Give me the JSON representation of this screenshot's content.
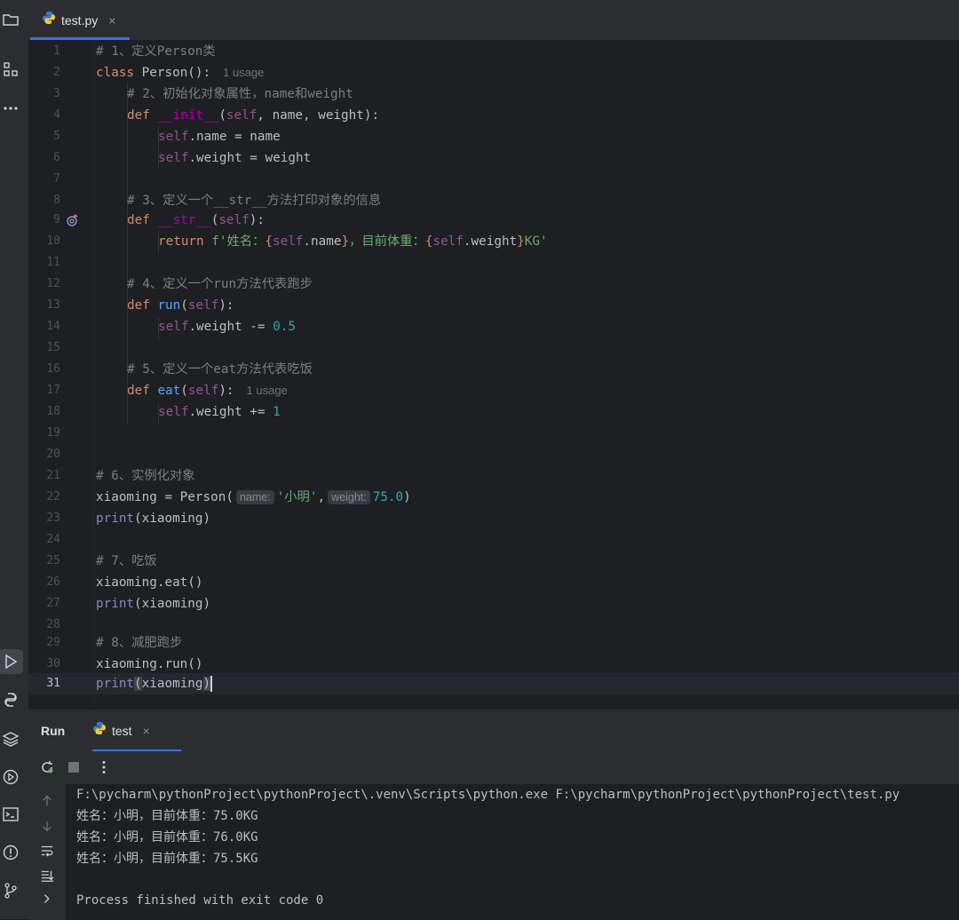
{
  "editor_tab": {
    "label": "test.py"
  },
  "gutter": [
    "1",
    "2",
    "3",
    "4",
    "5",
    "6",
    "7",
    "8",
    "9",
    "10",
    "11",
    "12",
    "13",
    "14",
    "15",
    "16",
    "17",
    "18",
    "19",
    "20",
    "21",
    "22",
    "23",
    "24",
    "25",
    "26",
    "27",
    "28",
    "29",
    "30",
    "31"
  ],
  "code": {
    "l1": "# 1、定义Person类",
    "l2_kw": "class",
    "l2_name": " Person():",
    "l2_hint": "1 usage",
    "l3": "# 2、初始化对象属性，name和weight",
    "l4_kw": "def ",
    "l4_fn": "__init__",
    "l4_a": "(",
    "l4_self": "self",
    "l4_b": ", name, weight):",
    "l5_self": "self",
    "l5_rest": ".name = name",
    "l6_self": "self",
    "l6_rest": ".weight = weight",
    "l8": "# 3、定义一个__str__方法打印对象的信息",
    "l9_kw": "def ",
    "l9_fn": "__str__",
    "l9_a": "(",
    "l9_self": "self",
    "l9_b": "):",
    "l10_kw": "return ",
    "l10_s1": "f'姓名：",
    "l10_b1": "{",
    "l10_self1": "self",
    "l10_n1": ".name",
    "l10_b2": "}",
    "l10_s2": "，目前体重：",
    "l10_b3": "{",
    "l10_self2": "self",
    "l10_n2": ".weight",
    "l10_b4": "}",
    "l10_s3": "KG'",
    "l12": "# 4、定义一个run方法代表跑步",
    "l13_kw": "def ",
    "l13_fn": "run",
    "l13_a": "(",
    "l13_self": "self",
    "l13_b": "):",
    "l14_self": "self",
    "l14_rest": ".weight -= ",
    "l14_num": "0.5",
    "l16": "# 5、定义一个eat方法代表吃饭",
    "l17_kw": "def ",
    "l17_fn": "eat",
    "l17_a": "(",
    "l17_self": "self",
    "l17_b": "):",
    "l17_hint": "1 usage",
    "l18_self": "self",
    "l18_rest": ".weight += ",
    "l18_num": "1",
    "l21": "# 6、实例化对象",
    "l22_a": "xiaoming = Person(",
    "l22_hint1": "name:",
    "l22_s": "'小明'",
    "l22_c": ",",
    "l22_hint2": "weight:",
    "l22_num": "75.0",
    "l22_e": ")",
    "l23_bi": "print",
    "l23_rest": "(xiaoming)",
    "l25": "# 7、吃饭",
    "l26": "xiaoming.eat()",
    "l27_bi": "print",
    "l27_rest": "(xiaoming)",
    "l29": "# 8、减肥跑步",
    "l30": "xiaoming.run()",
    "l31_bi": "print",
    "l31_p1": "(",
    "l31_mid": "xiaoming",
    "l31_p2": ")"
  },
  "run_panel": {
    "title": "Run",
    "tab_label": "test",
    "console": [
      "F:\\pycharm\\pythonProject\\pythonProject\\.venv\\Scripts\\python.exe F:\\pycharm\\pythonProject\\pythonProject\\test.py",
      "姓名：小明，目前体重：75.0KG",
      "姓名：小明，目前体重：76.0KG",
      "姓名：小明，目前体重：75.5KG",
      "",
      "Process finished with exit code 0"
    ]
  },
  "colors": {
    "accent": "#3574f0",
    "keyword": "#cf8e6d",
    "string": "#6aab73",
    "number": "#2aacb8",
    "function": "#56a8f5",
    "self": "#94558d",
    "comment": "#7a7e85"
  },
  "icons": [
    "folder-icon",
    "structure-icon",
    "more-icon",
    "run-tool-icon",
    "python-console-icon",
    "layers-icon",
    "services-icon",
    "terminal-icon",
    "problems-icon",
    "git-icon",
    "python-file-icon",
    "rerun-icon",
    "stop-icon",
    "kebab-icon",
    "scroll-up-icon",
    "scroll-down-icon",
    "soft-wrap-icon",
    "scroll-end-icon",
    "expand-icon",
    "override-icon",
    "close-icon"
  ]
}
